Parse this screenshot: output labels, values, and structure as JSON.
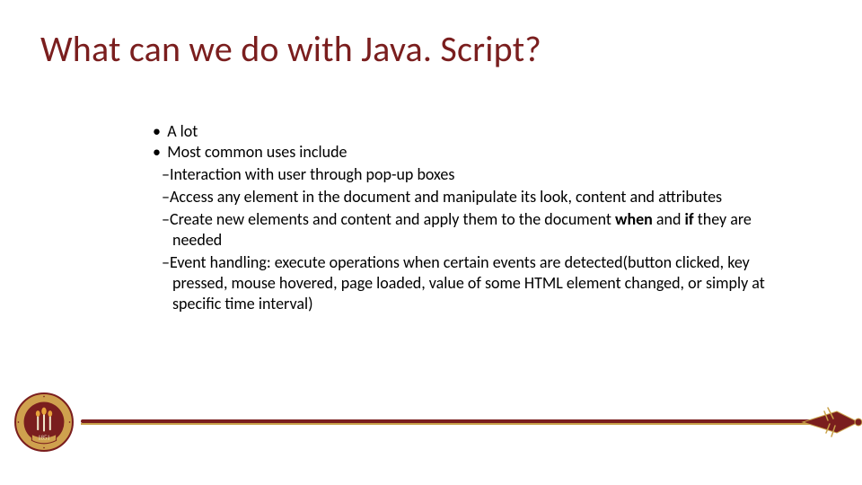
{
  "slide": {
    "title": "What can we do with Java. Script?",
    "bullets": {
      "b1a": "A lot",
      "b1b": "Most common uses include",
      "b2a": "Interaction with user through pop-up boxes",
      "b2b": "Access any element in the document and manipulate its look, content and attributes",
      "b2c_pre": "Create new elements and content and apply them to the document ",
      "b2c_when": "when",
      "b2c_mid": " and ",
      "b2c_if": "if",
      "b2c_post": " they are needed",
      "b2d": "Event handling: execute operations when certain events are detected(button clicked, key pressed, mouse hovered, page loaded, value of some HTML element changed, or simply at specific time interval)"
    },
    "footer": {
      "seal_year": "1851"
    },
    "colors": {
      "garnet": "#7a1e1e",
      "gold": "#c9a24a"
    }
  }
}
